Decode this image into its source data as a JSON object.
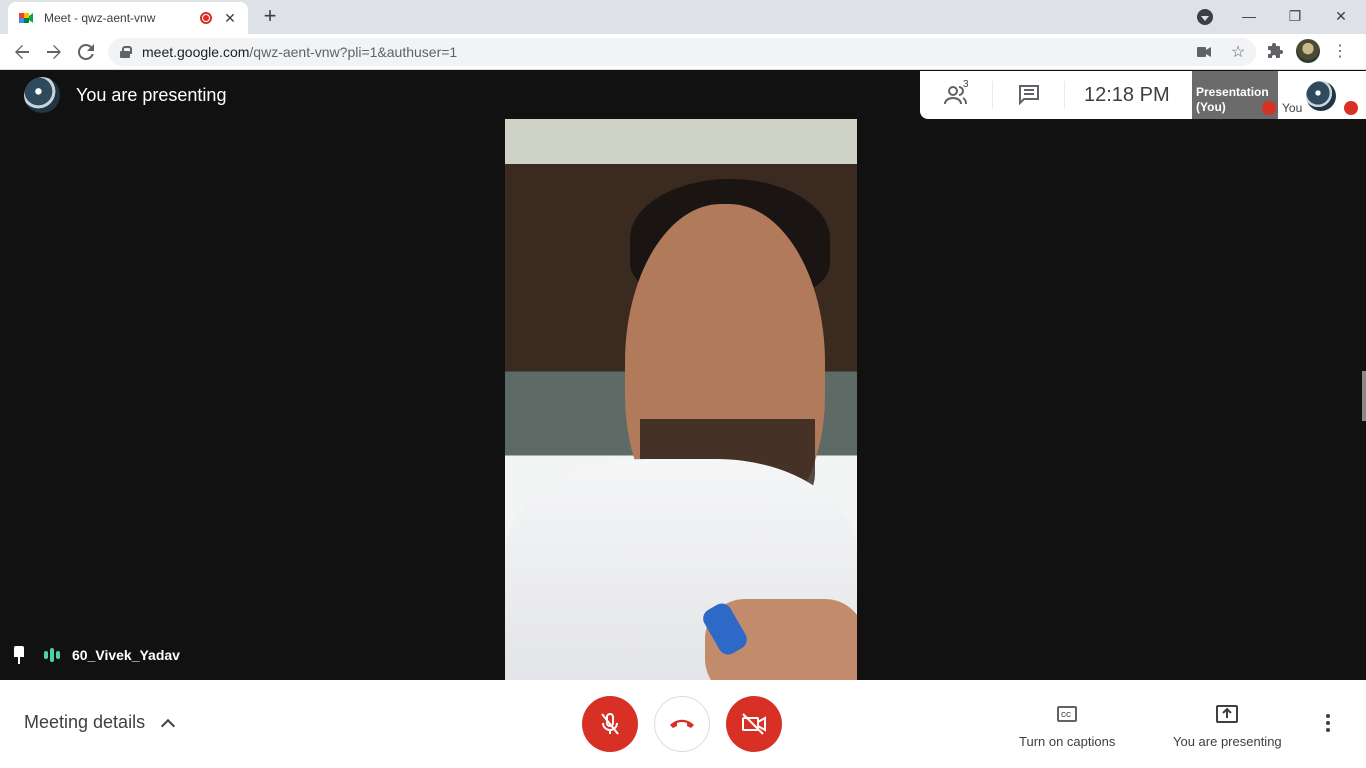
{
  "browser": {
    "tab_title": "Meet - qwz-aent-vnw",
    "tab_close": "✕",
    "new_tab": "+",
    "url_host": "meet.google.com",
    "url_path": "/qwz-aent-vnw?pli=1&authuser=1",
    "window_minimize": "—",
    "window_restore": "❐",
    "window_close": "✕"
  },
  "meet": {
    "presenting_banner": "You are presenting",
    "participant_name": "60_Vivek_Yadav",
    "people_count": "3",
    "clock": "12:18  PM",
    "presentation_tile_label": "Presentation (You)",
    "self_tile_label": "You"
  },
  "bottom": {
    "meeting_details": "Meeting details",
    "captions_label": "Turn on captions",
    "present_label": "You are presenting"
  },
  "colors": {
    "end_call_red": "#d93025",
    "audio_indicator": "#4fd1a5"
  }
}
